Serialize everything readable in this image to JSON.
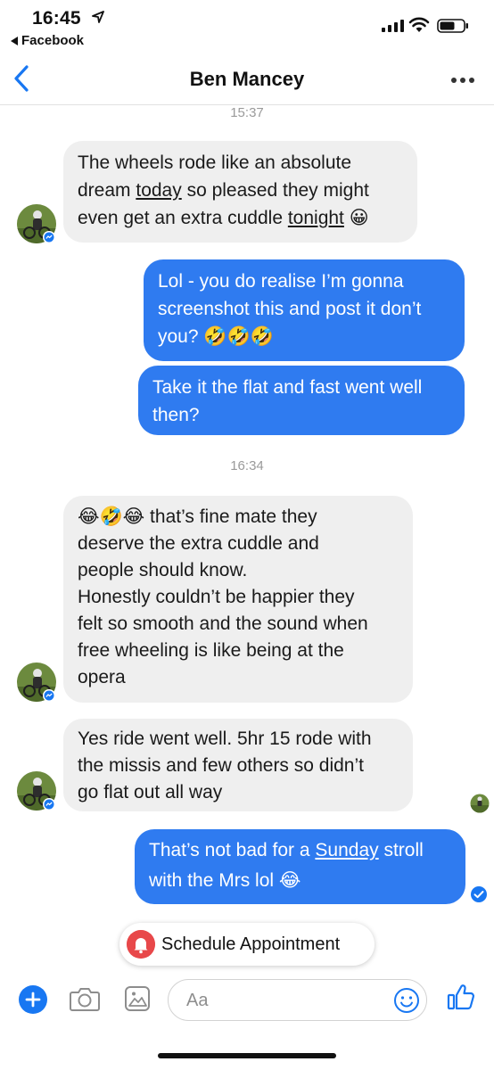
{
  "status_bar": {
    "time": "16:45",
    "back_app": "Facebook"
  },
  "header": {
    "contact_name": "Ben Mancey"
  },
  "timestamps": [
    "15:37",
    "16:34"
  ],
  "messages": {
    "m1": {
      "line1": "The wheels rode like an absolute",
      "line2a": "dream ",
      "line2b": "today",
      "line2c": " so pleased they might",
      "line3a": "even get an extra cuddle ",
      "line3b": "tonight",
      "line3c": " 😀"
    },
    "m2": {
      "line1": "Lol - you do realise I’m gonna",
      "line2": "screenshot this and post it don’t",
      "line3": "you? 🤣🤣🤣"
    },
    "m3": {
      "line1": "Take it the flat and fast went well",
      "line2": "then?"
    },
    "m4": {
      "line1": "😂🤣😂 that’s fine mate they",
      "line2": "deserve the extra cuddle and",
      "line3": "people should know.",
      "line4": "Honestly couldn’t be happier they",
      "line5": "felt so smooth and the sound when",
      "line6": "free wheeling is like being at the",
      "line7": "opera"
    },
    "m5": {
      "line1": "Yes ride went well. 5hr 15 rode with",
      "line2": "the missis and few others so didn’t",
      "line3": "go flat out all way"
    },
    "m6": {
      "line1a": "That’s not bad for a ",
      "line1b": "Sunday",
      "line1c": " stroll",
      "line2": "with the Mrs lol 😂"
    }
  },
  "quick_action": {
    "label": "Schedule Appointment"
  },
  "composer": {
    "placeholder": "Aa"
  },
  "colors": {
    "outgoing_bubble": "#2f7bf0",
    "incoming_bubble": "#efefef",
    "accent": "#1877f2"
  }
}
